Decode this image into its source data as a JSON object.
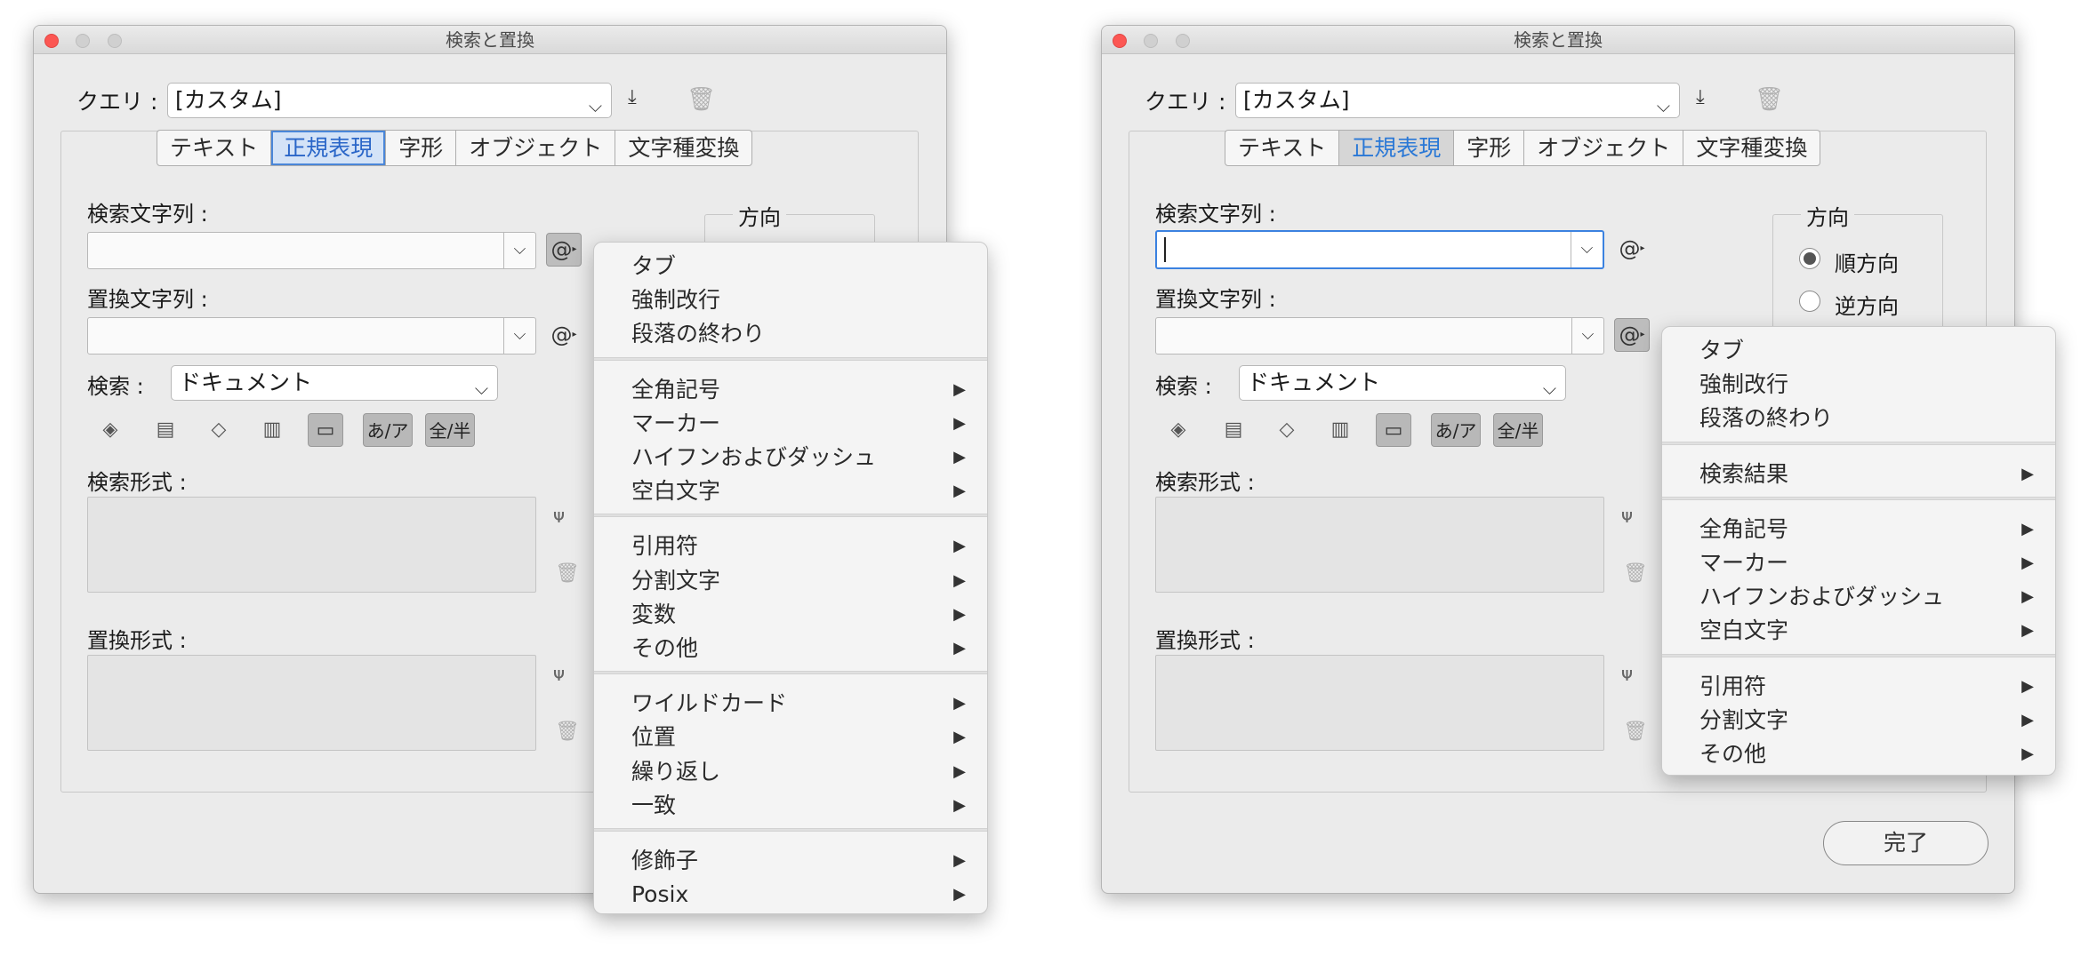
{
  "window": {
    "title": "検索と置換"
  },
  "query": {
    "label": "クエリ :",
    "value": "[カスタム]"
  },
  "tabs": [
    "テキスト",
    "正規表現",
    "字形",
    "オブジェクト",
    "文字種変換"
  ],
  "find": {
    "label": "検索文字列 :",
    "value": ""
  },
  "replace": {
    "label": "置換文字列 :",
    "value": ""
  },
  "search": {
    "label": "検索 :",
    "value": "ドキュメント"
  },
  "options": {
    "kana_label": "あ/ア",
    "width_label": "全/半"
  },
  "find_format": {
    "label": "検索形式 :"
  },
  "replace_format": {
    "label": "置換形式 :"
  },
  "direction": {
    "label": "方向",
    "forward": "順方向",
    "backward": "逆方向"
  },
  "done": "完了",
  "special": {
    "at": "@"
  },
  "menu1": {
    "groups": [
      [
        {
          "label": "タブ",
          "sub": false
        },
        {
          "label": "強制改行",
          "sub": false
        },
        {
          "label": "段落の終わり",
          "sub": false
        }
      ],
      [
        {
          "label": "全角記号",
          "sub": true
        },
        {
          "label": "マーカー",
          "sub": true
        },
        {
          "label": "ハイフンおよびダッシュ",
          "sub": true
        },
        {
          "label": "空白文字",
          "sub": true
        }
      ],
      [
        {
          "label": "引用符",
          "sub": true
        },
        {
          "label": "分割文字",
          "sub": true
        },
        {
          "label": "変数",
          "sub": true
        },
        {
          "label": "その他",
          "sub": true
        }
      ],
      [
        {
          "label": "ワイルドカード",
          "sub": true
        },
        {
          "label": "位置",
          "sub": true
        },
        {
          "label": "繰り返し",
          "sub": true
        },
        {
          "label": "一致",
          "sub": true
        }
      ],
      [
        {
          "label": "修飾子",
          "sub": true
        },
        {
          "label": "Posix",
          "sub": true
        }
      ]
    ]
  },
  "menu2": {
    "groups": [
      [
        {
          "label": "タブ",
          "sub": false
        },
        {
          "label": "強制改行",
          "sub": false
        },
        {
          "label": "段落の終わり",
          "sub": false
        }
      ],
      [
        {
          "label": "検索結果",
          "sub": true
        }
      ],
      [
        {
          "label": "全角記号",
          "sub": true
        },
        {
          "label": "マーカー",
          "sub": true
        },
        {
          "label": "ハイフンおよびダッシュ",
          "sub": true
        },
        {
          "label": "空白文字",
          "sub": true
        }
      ],
      [
        {
          "label": "引用符",
          "sub": true
        },
        {
          "label": "分割文字",
          "sub": true
        },
        {
          "label": "その他",
          "sub": true
        }
      ]
    ]
  },
  "icons": {
    "download": "download-icon",
    "trash": "trash-icon",
    "locked_layers": "locked-layers-icon",
    "locked_stories": "locked-stories-icon",
    "hidden_layers": "layers-icon",
    "master_pages": "master-pages-icon",
    "footnotes": "footnotes-icon",
    "format": "format-icon",
    "submenu": "submenu-arrow-icon"
  },
  "colors": {
    "accent": "#2a66c8",
    "focus": "#3b82e0",
    "close": "#fc5753"
  }
}
